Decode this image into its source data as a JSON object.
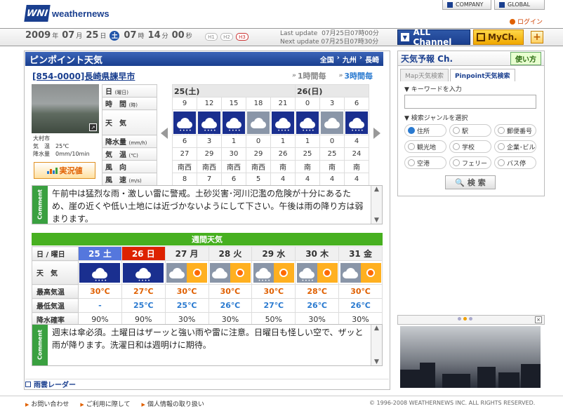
{
  "header": {
    "logo_mark": "WNI",
    "logo_text": "weathernews",
    "company_label": "COMPANY",
    "global_label": "GLOBAL",
    "login_label": "ログイン"
  },
  "datebar": {
    "year": "2009",
    "year_unit": "年",
    "month": "07",
    "month_unit": "月",
    "day": "25",
    "day_unit": "日",
    "weekday": "土",
    "hour": "07",
    "hour_unit": "時",
    "minute": "14",
    "minute_unit": "分",
    "second": "00",
    "second_unit": "秒",
    "h_buttons": [
      "H1",
      "H2",
      "H3"
    ],
    "last_update_label": "Last update",
    "last_update_value": "07月25日07時00分",
    "next_update_label": "Next update",
    "next_update_value": "07月25日07時30分"
  },
  "channels": {
    "all": "ALL Channel",
    "my": "MyCh.",
    "add": "+"
  },
  "main": {
    "title": "ピンポイント天気",
    "breadcrumb": [
      "全国",
      "九州",
      "長崎"
    ],
    "location": "[854-0000]長崎県諫早市",
    "tab_1h": "1時間毎",
    "tab_3h": "3時間毎",
    "station": {
      "name": "大村市",
      "temp_label": "気　温",
      "temp": "25℃",
      "rain_label": "降水量",
      "rain": "0mm/10min"
    },
    "jikkyo_button": "実況値"
  },
  "hourly": {
    "row_labels": {
      "day": "日",
      "day_sub": "(曜日)",
      "time": "時　間",
      "time_sub": "(時)",
      "wx": "天　気",
      "rain": "降水量",
      "rain_sub": "(mm/h)",
      "temp": "気　温",
      "temp_sub": "(℃)",
      "wind": "風　向",
      "wind2": "風　速",
      "wind_sub": "(m/s)"
    },
    "day1": "25(土)",
    "day2": "26(日)",
    "times": [
      "9",
      "12",
      "15",
      "18",
      "21",
      "0",
      "3",
      "6"
    ],
    "weather": [
      "rain",
      "rain",
      "rain",
      "cloudy",
      "rain",
      "rain",
      "cloudy",
      "rain"
    ],
    "rain": [
      "6",
      "3",
      "1",
      "0",
      "1",
      "1",
      "0",
      "4"
    ],
    "temp": [
      "27",
      "29",
      "30",
      "29",
      "26",
      "25",
      "25",
      "24"
    ],
    "wind_dir": [
      "南西",
      "南西",
      "南西",
      "南西",
      "南",
      "南",
      "南",
      "南"
    ],
    "wind_speed": [
      "8",
      "7",
      "6",
      "5",
      "4",
      "4",
      "4",
      "4"
    ],
    "comment": "午前中は猛烈な雨・激しい雷に警戒。土砂災害･河川氾濫の危険が十分にあるため、崖の近くや低い土地には近づかないようにして下さい。午後は雨の降り方は弱まります。",
    "comment_label": "Comment"
  },
  "weekly": {
    "title": "週間天気",
    "labels": {
      "date": "日 / 曜日",
      "wx": "天　気",
      "hi": "最高気温",
      "lo": "最低気温",
      "pop": "降水確率"
    },
    "dates": [
      "25 土",
      "26 日",
      "27 月",
      "28 火",
      "29 水",
      "30 木",
      "31 金"
    ],
    "weather": [
      "rain",
      "rain",
      "cloud-sun",
      "cloud-sun",
      "cloud-rain-sun",
      "cloud-rain-sun",
      "cloud-sun"
    ],
    "hi": [
      "30℃",
      "27℃",
      "30℃",
      "30℃",
      "30℃",
      "28℃",
      "30℃"
    ],
    "lo": [
      "-",
      "25℃",
      "25℃",
      "26℃",
      "27℃",
      "26℃",
      "26℃"
    ],
    "pop": [
      "90%",
      "90%",
      "30%",
      "30%",
      "50%",
      "30%",
      "30%"
    ],
    "comment": "週末は傘必須。土曜日はザーッと強い雨や雷に注意。日曜日も怪しい空で、ザッと雨が降ります。洗濯日和は週明けに期待。",
    "comment_label": "Comment"
  },
  "radar_label": "雨雲レーダー",
  "side": {
    "title": "天気予報 Ch.",
    "use_label": "使い方",
    "tab_map": "Map天気検索",
    "tab_pinpoint": "Pinpoint天気検索",
    "keyword_label": "▼ キーワードを入力",
    "keyword_value": "",
    "genre_label": "▼ 検索ジャンルを選択",
    "genres": [
      "住所",
      "駅",
      "郵便番号",
      "観光地",
      "学校",
      "企業･ビル",
      "空港",
      "フェリー",
      "バス停"
    ],
    "search_button": "検 索"
  },
  "footer": {
    "links": [
      "お問い合わせ",
      "ご利用に際して",
      "個人情報の取り扱い"
    ],
    "copyright": "© 1996-2008 WEATHERNEWS INC. ALL RIGHTS RESERVED."
  },
  "colors": {
    "brand": "#1a3f8f",
    "accent": "#f0a800",
    "weekly_header": "#47b020",
    "saturday": "#5577dd",
    "sunday": "#dd2200"
  }
}
